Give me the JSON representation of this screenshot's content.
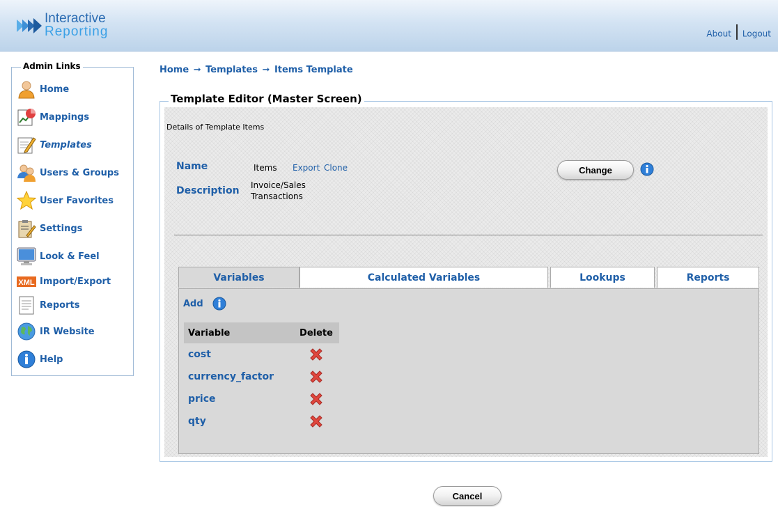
{
  "header": {
    "logo_line1": "Interactive",
    "logo_line2": "Reporting",
    "about": "About",
    "logout": "Logout"
  },
  "sidebar": {
    "title": "Admin Links",
    "items": [
      {
        "label": "Home",
        "icon": "user-icon"
      },
      {
        "label": "Mappings",
        "icon": "chart-icon"
      },
      {
        "label": "Templates",
        "icon": "edit-icon"
      },
      {
        "label": "Users & Groups",
        "icon": "users-icon"
      },
      {
        "label": "User Favorites",
        "icon": "star-icon"
      },
      {
        "label": "Settings",
        "icon": "clipboard-icon"
      },
      {
        "label": "Look & Feel",
        "icon": "monitor-icon"
      },
      {
        "label": "Import/Export",
        "icon": "xml-icon"
      },
      {
        "label": "Reports",
        "icon": "document-icon"
      },
      {
        "label": "IR Website",
        "icon": "globe-icon"
      },
      {
        "label": "Help",
        "icon": "info-icon"
      }
    ]
  },
  "breadcrumb": {
    "home": "Home",
    "arrow": "➞",
    "templates": "Templates",
    "current": "Items Template"
  },
  "editor": {
    "legend": "Template Editor (Master Screen)",
    "caption": "Details of Template Items",
    "name_label": "Name",
    "name_value": "Items",
    "export_link": "Export",
    "clone_link": "Clone",
    "description_label": "Description",
    "description_value": "Invoice/Sales Transactions",
    "change_button": "Change"
  },
  "tabs": [
    {
      "label": "Variables",
      "active": true
    },
    {
      "label": "Calculated Variables",
      "active": false
    },
    {
      "label": "Lookups",
      "active": false
    },
    {
      "label": "Reports",
      "active": false
    }
  ],
  "variables": {
    "add_label": "Add",
    "columns": [
      "Variable",
      "Delete"
    ],
    "rows": [
      "cost",
      "currency_factor",
      "price",
      "qty"
    ]
  },
  "footer": {
    "cancel_button": "Cancel"
  },
  "colors": {
    "link": "#1f5fa8",
    "header_gradient_bottom": "#bcd3ea",
    "panel_gray": "#d9d9d9",
    "delete_red": "#e0473e"
  }
}
